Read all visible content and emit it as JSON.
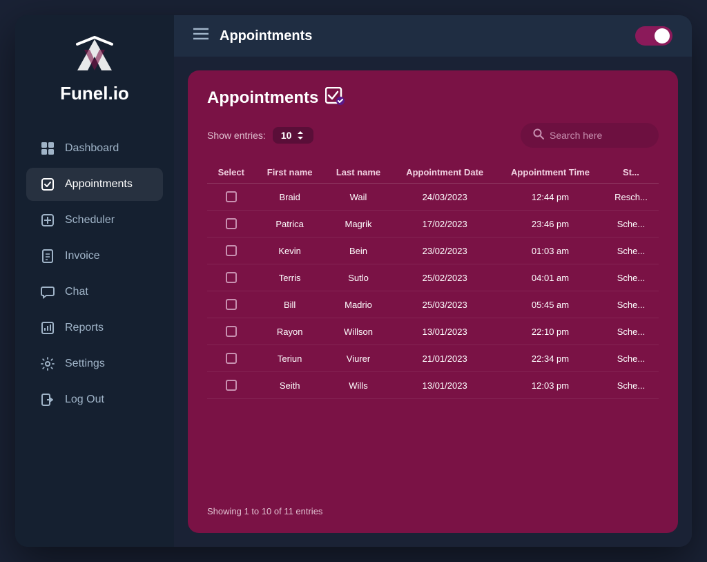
{
  "app": {
    "title": "Funel.io"
  },
  "topbar": {
    "title": "Appointments",
    "toggle_on": true
  },
  "sidebar": {
    "items": [
      {
        "id": "dashboard",
        "label": "Dashboard",
        "icon": "⊞",
        "active": false
      },
      {
        "id": "appointments",
        "label": "Appointments",
        "icon": "✔",
        "active": true
      },
      {
        "id": "scheduler",
        "label": "Scheduler",
        "icon": "⊕",
        "active": false
      },
      {
        "id": "invoice",
        "label": "Invoice",
        "icon": "📄",
        "active": false
      },
      {
        "id": "chat",
        "label": "Chat",
        "icon": "💬",
        "active": false
      },
      {
        "id": "reports",
        "label": "Reports",
        "icon": "📊",
        "active": false
      },
      {
        "id": "settings",
        "label": "Settings",
        "icon": "⚙",
        "active": false
      },
      {
        "id": "logout",
        "label": "Log Out",
        "icon": "🔒",
        "active": false
      }
    ]
  },
  "card": {
    "title": "Appointments",
    "show_entries_label": "Show entries:",
    "entries_value": "10",
    "search_placeholder": "Search here",
    "columns": [
      "Select",
      "First name",
      "Last name",
      "Appointment Date",
      "Appointment Time",
      "St..."
    ],
    "rows": [
      {
        "first": "Braid",
        "last": "Wail",
        "date": "24/03/2023",
        "time": "12:44 pm",
        "status": "Resch..."
      },
      {
        "first": "Patrica",
        "last": "Magrik",
        "date": "17/02/2023",
        "time": "23:46 pm",
        "status": "Sche..."
      },
      {
        "first": "Kevin",
        "last": "Bein",
        "date": "23/02/2023",
        "time": "01:03 am",
        "status": "Sche..."
      },
      {
        "first": "Terris",
        "last": "Sutlo",
        "date": "25/02/2023",
        "time": "04:01 am",
        "status": "Sche..."
      },
      {
        "first": "Bill",
        "last": "Madrio",
        "date": "25/03/2023",
        "time": "05:45 am",
        "status": "Sche..."
      },
      {
        "first": "Rayon",
        "last": "Willson",
        "date": "13/01/2023",
        "time": "22:10 pm",
        "status": "Sche..."
      },
      {
        "first": "Teriun",
        "last": "Viurer",
        "date": "21/01/2023",
        "time": "22:34 pm",
        "status": "Sche..."
      },
      {
        "first": "Seith",
        "last": "Wills",
        "date": "13/01/2023",
        "time": "12:03 pm",
        "status": "Sche..."
      }
    ],
    "footer": "Showing 1 to 10 of 11 entries"
  },
  "colors": {
    "sidebar_bg": "#152030",
    "card_bg": "#7a1245",
    "accent": "#8b1a5a"
  }
}
